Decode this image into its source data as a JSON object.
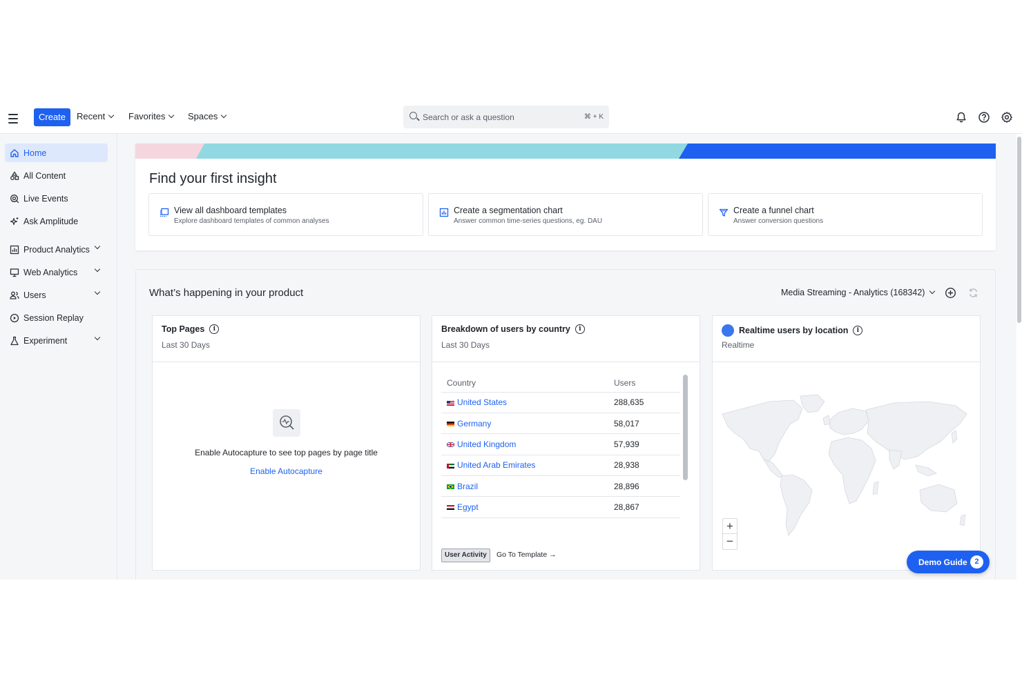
{
  "topbar": {
    "create_label": "Create",
    "menus": [
      "Recent",
      "Favorites",
      "Spaces"
    ],
    "search_placeholder": "Search or ask a question",
    "search_shortcut": "⌘ + K",
    "icons": [
      "bell-icon",
      "help-icon",
      "gear-icon"
    ]
  },
  "sidebar": {
    "items": [
      {
        "label": "Home",
        "icon": "home-icon",
        "active": true
      },
      {
        "label": "All Content",
        "icon": "shapes-icon"
      },
      {
        "label": "Live Events",
        "icon": "live-events-icon"
      },
      {
        "label": "Ask Amplitude",
        "icon": "sparkle-icon"
      },
      {
        "label": "Product Analytics",
        "icon": "bar-chart-icon",
        "expandable": true
      },
      {
        "label": "Web Analytics",
        "icon": "monitor-icon",
        "expandable": true
      },
      {
        "label": "Users",
        "icon": "users-icon",
        "expandable": true
      },
      {
        "label": "Session Replay",
        "icon": "play-circle-icon"
      },
      {
        "label": "Experiment",
        "icon": "flask-icon",
        "expandable": true
      }
    ]
  },
  "insight": {
    "title": "Find your first insight",
    "cards": [
      {
        "title": "View all dashboard templates",
        "subtitle": "Explore dashboard templates of common analyses",
        "icon": "dashboard-template-icon"
      },
      {
        "title": "Create a segmentation chart",
        "subtitle": "Answer common time-series questions, eg. DAU",
        "icon": "segmentation-chart-icon"
      },
      {
        "title": "Create a funnel chart",
        "subtitle": "Answer conversion questions",
        "icon": "funnel-icon"
      }
    ]
  },
  "happening": {
    "title": "What’s happening in your product",
    "project": "Media Streaming - Analytics (168342)"
  },
  "widgets": {
    "top_pages": {
      "title": "Top Pages",
      "subtitle": "Last 30 Days",
      "empty_message": "Enable Autocapture to see top pages by page title",
      "empty_link": "Enable Autocapture"
    },
    "country": {
      "title": "Breakdown of users by country",
      "subtitle": "Last 30 Days",
      "columns": [
        "Country",
        "Users"
      ],
      "rows": [
        {
          "country": "United States",
          "users": "288,635"
        },
        {
          "country": "Germany",
          "users": "58,017"
        },
        {
          "country": "United Kingdom",
          "users": "57,939"
        },
        {
          "country": "United Arab Emirates",
          "users": "28,938"
        },
        {
          "country": "Brazil",
          "users": "28,896"
        },
        {
          "country": "Egypt",
          "users": "28,867"
        }
      ],
      "chip_label": "User Activity",
      "goto_label": "Go To Template"
    },
    "realtime": {
      "title": "Realtime users by location",
      "subtitle": "Realtime",
      "zoom_in": "+",
      "zoom_out": "−"
    }
  },
  "demo_guide": {
    "label": "Demo Guide",
    "count": "2"
  },
  "colors": {
    "accent": "#1e61f0",
    "banner_pink": "#f5d6df",
    "banner_teal": "#91d8e3",
    "banner_blue": "#1e61f0"
  }
}
